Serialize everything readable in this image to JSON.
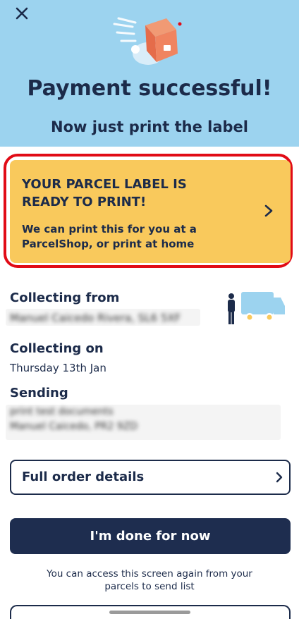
{
  "header": {
    "close_icon": "close-icon",
    "title": "Payment successful!",
    "subtitle": "Now just print the label"
  },
  "label_card": {
    "heading_line1": "YOUR PARCEL LABEL IS",
    "heading_line2": "READY TO PRINT!",
    "body_line1": "We can print this for you at a",
    "body_line2": "ParcelShop, or print at home",
    "chevron_icon": "chevron-right-icon",
    "bg_color": "#f9c95c",
    "highlight_color": "#e10b16"
  },
  "collecting_from": {
    "label": "Collecting from",
    "value": "Manuel Caicedo Rivera, SL6 5XF"
  },
  "collecting_on": {
    "label": "Collecting on",
    "value": "Thursday 13th Jan"
  },
  "sending": {
    "label": "Sending",
    "line1": "print test documents",
    "line2": "Manuel Caicedo, PR2 9ZD"
  },
  "buttons": {
    "full_order_details": "Full order details",
    "done": "I'm done for now"
  },
  "footnote": {
    "line1": "You can access this screen again from your",
    "line2": "parcels to send list"
  },
  "colors": {
    "hero_bg": "#9cd3ef",
    "navy": "#1c2b4a"
  }
}
